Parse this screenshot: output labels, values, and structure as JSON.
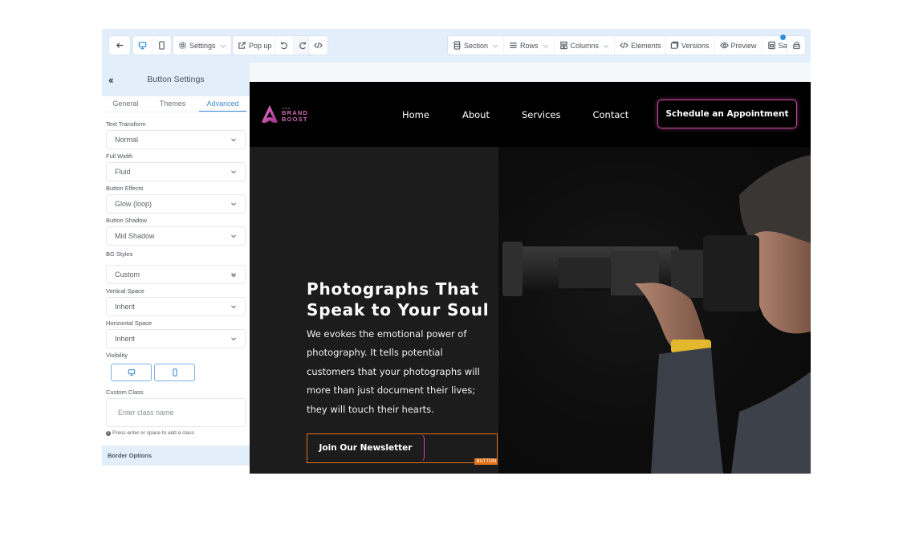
{
  "toolbar": {
    "left": {
      "back_icon": "arrow-left-icon",
      "desktop_icon": "desktop-icon",
      "mobile_icon": "mobile-icon",
      "settings_label": "Settings",
      "popup_label": "Pop up",
      "undo_icon": "undo-icon",
      "redo_icon": "redo-icon",
      "code_icon": "code-icon"
    },
    "right": {
      "section_label": "Section",
      "rows_label": "Rows",
      "columns_label": "Columns",
      "elements_label": "Elements",
      "versions_label": "Versions",
      "preview_label": "Preview",
      "save_label": "Save",
      "lock_icon": "lock-icon"
    }
  },
  "sidebar": {
    "title": "Button Settings",
    "collapse_icon": "double-chevron-left-icon",
    "tabs": [
      {
        "label": "General",
        "active": false
      },
      {
        "label": "Themes",
        "active": false
      },
      {
        "label": "Advanced",
        "active": true
      }
    ],
    "fields": {
      "text_transform": {
        "label": "Text Transform",
        "value": "Normal"
      },
      "full_width": {
        "label": "Full Width",
        "value": "Fluid"
      },
      "button_effects": {
        "label": "Button Effects",
        "value": "Glow (loop)"
      },
      "button_shadow": {
        "label": "Button Shadow",
        "value": "Mid Shadow"
      },
      "bg_styles": {
        "label": "BG Styles",
        "value": "Custom"
      },
      "vertical_space": {
        "label": "Vertical Space",
        "value": "Inherit"
      },
      "horizontal_space": {
        "label": "Horizontal Space",
        "value": "Inherit"
      },
      "visibility": {
        "label": "Visibility"
      },
      "custom_class": {
        "label": "Custom Class",
        "placeholder": "Enter class name",
        "hint": "Press enter or space to add a class"
      }
    },
    "border_options_label": "Border Options"
  },
  "site": {
    "logo": {
      "tiny": "LOGO",
      "line1": "BRAND",
      "line2": "BOOST"
    },
    "nav": [
      "Home",
      "About",
      "Services",
      "Contact"
    ],
    "cta": "Schedule an Appointment",
    "hero": {
      "title_line1": "Photographs That",
      "title_line2": "Speak to Your Soul",
      "description": "We evokes the emotional power of photography. It tells potential customers that your photographs will more than just document their lives; they will touch their hearts.",
      "button_label": "Join Our Newsletter",
      "selected_tag": "BUTTON"
    }
  },
  "colors": {
    "accent": "#3b8ad6",
    "brand_pink": "#d04fa0",
    "selection_orange": "#e2731b"
  }
}
